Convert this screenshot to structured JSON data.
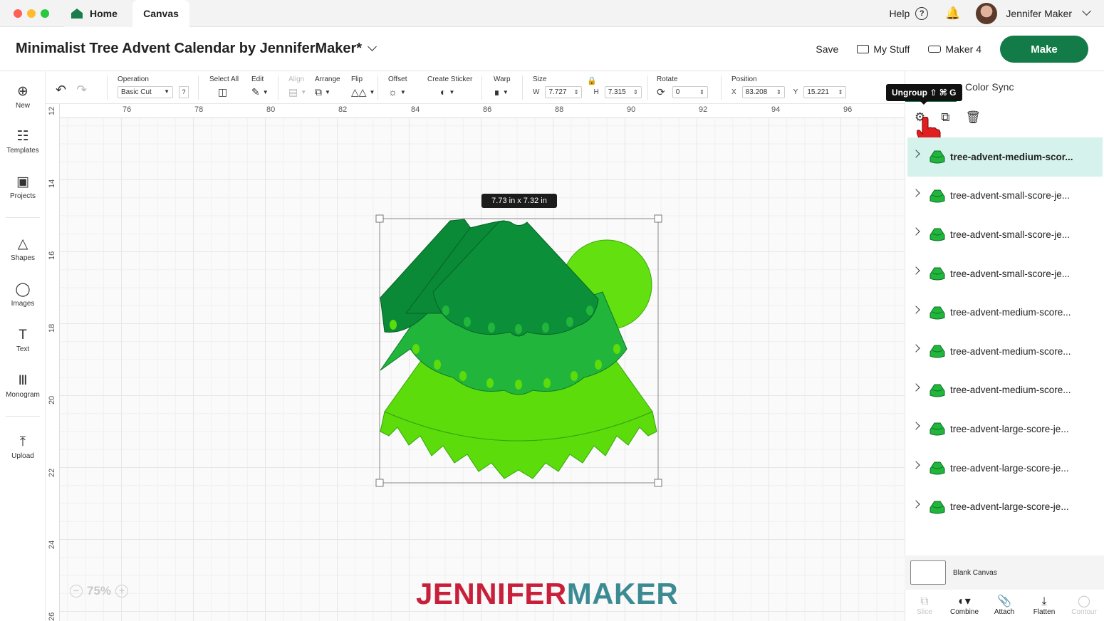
{
  "window": {
    "tabs": [
      {
        "label": "Home"
      },
      {
        "label": "Canvas"
      }
    ],
    "help_label": "Help",
    "help_icon": "?",
    "user_name": "Jennifer Maker"
  },
  "header": {
    "project_title": "Minimalist Tree Advent Calendar by JenniferMaker*",
    "save_label": "Save",
    "my_stuff_label": "My Stuff",
    "machine_label": "Maker 4",
    "make_label": "Make"
  },
  "sidebar": {
    "items": [
      {
        "label": "New",
        "icon": "plus-circle-icon"
      },
      {
        "label": "Templates",
        "icon": "shirt-icon"
      },
      {
        "label": "Projects",
        "icon": "projects-icon"
      },
      {
        "label": "Shapes",
        "icon": "shapes-icon"
      },
      {
        "label": "Images",
        "icon": "lightbulb-icon"
      },
      {
        "label": "Text",
        "icon": "text-icon"
      },
      {
        "label": "Monogram",
        "icon": "monogram-icon"
      },
      {
        "label": "Upload",
        "icon": "upload-icon"
      }
    ]
  },
  "toolbar": {
    "operation_label": "Operation",
    "operation_value": "Basic Cut",
    "operation_help": "?",
    "select_all_label": "Select All",
    "edit_label": "Edit",
    "align_label": "Align",
    "arrange_label": "Arrange",
    "flip_label": "Flip",
    "offset_label": "Offset",
    "create_sticker_label": "Create Sticker",
    "warp_label": "Warp",
    "size_label": "Size",
    "size_w_label": "W",
    "size_w_value": "7.727",
    "size_h_label": "H",
    "size_h_value": "7.315",
    "rotate_label": "Rotate",
    "rotate_value": "0",
    "position_label": "Position",
    "pos_x_label": "X",
    "pos_x_value": "83.208",
    "pos_y_label": "Y",
    "pos_y_value": "15.221"
  },
  "canvas": {
    "ruler_top": [
      "76",
      "78",
      "80",
      "82",
      "84",
      "86",
      "88",
      "90",
      "92",
      "94",
      "96"
    ],
    "ruler_left": [
      "12",
      "14",
      "16",
      "18",
      "20",
      "22",
      "24",
      "26"
    ],
    "size_tooltip": "7.73  in x 7.32  in",
    "zoom_level": "75%",
    "zoom_out": "−",
    "zoom_in": "+",
    "watermark_part1": "JENNIFER",
    "watermark_part2": "MAKER",
    "shape_colors": {
      "dark": "#0a8a36",
      "mid": "#22b53b",
      "light": "#5cdc0a",
      "accent_circle": "#62e010"
    }
  },
  "panel": {
    "color_sync_label": "Color Sync",
    "tooltip_text": "Ungroup ⇧ ⌘ G",
    "layers": [
      {
        "name": "tree-advent-medium-scor...",
        "selected": true
      },
      {
        "name": "tree-advent-small-score-je...",
        "selected": false
      },
      {
        "name": "tree-advent-small-score-je...",
        "selected": false
      },
      {
        "name": "tree-advent-small-score-je...",
        "selected": false
      },
      {
        "name": "tree-advent-medium-score...",
        "selected": false
      },
      {
        "name": "tree-advent-medium-score...",
        "selected": false
      },
      {
        "name": "tree-advent-medium-score...",
        "selected": false
      },
      {
        "name": "tree-advent-large-score-je...",
        "selected": false
      },
      {
        "name": "tree-advent-large-score-je...",
        "selected": false
      },
      {
        "name": "tree-advent-large-score-je...",
        "selected": false
      }
    ],
    "blank_canvas_label": "Blank Canvas",
    "bottom_tools": [
      {
        "label": "Slice",
        "disabled": true
      },
      {
        "label": "Combine",
        "disabled": false
      },
      {
        "label": "Attach",
        "disabled": false
      },
      {
        "label": "Flatten",
        "disabled": false
      },
      {
        "label": "Contour",
        "disabled": true
      }
    ],
    "accent_color": "#137b47",
    "selected_row_color": "#d5f3ec"
  }
}
